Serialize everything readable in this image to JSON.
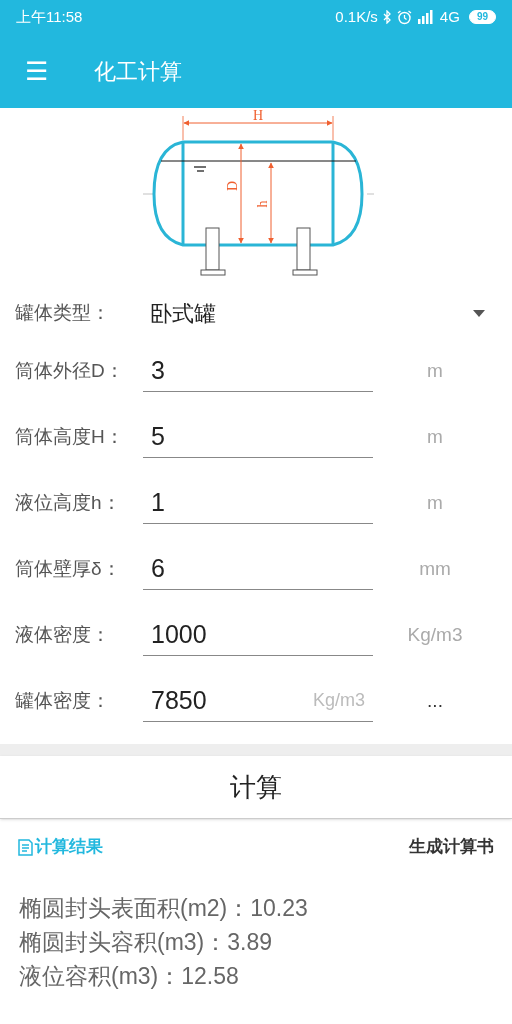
{
  "status_bar": {
    "time": "上午11:58",
    "network_speed": "0.1K/s",
    "network_type": "4G",
    "battery": "99"
  },
  "app_bar": {
    "menu_icon": "☰",
    "title": "化工计算"
  },
  "diagram": {
    "labels": [
      "H",
      "D",
      "h"
    ]
  },
  "tank_type": {
    "label": "罐体类型：",
    "value": "卧式罐"
  },
  "fields": [
    {
      "label": "筒体外径D：",
      "value": "3",
      "unit": "m",
      "unit_inside": false
    },
    {
      "label": "筒体高度H：",
      "value": "5",
      "unit": "m",
      "unit_inside": false
    },
    {
      "label": "液位高度h：",
      "value": "1",
      "unit": "m",
      "unit_inside": false
    },
    {
      "label": "筒体壁厚δ：",
      "value": "6",
      "unit": "mm",
      "unit_inside": false
    },
    {
      "label": "液体密度：",
      "value": "1000",
      "unit": "Kg/m3",
      "unit_inside": false
    },
    {
      "label": "罐体密度：",
      "value": "7850",
      "unit": "Kg/m3",
      "unit_inside": true,
      "more": "..."
    }
  ],
  "calculate_button": "计算",
  "results": {
    "title": "计算结果",
    "report_button": "生成计算书",
    "lines": [
      "椭圆封头表面积(m2)：10.23",
      "椭圆封头容积(m3)：3.89",
      "液位容积(m3)：12.58"
    ]
  }
}
